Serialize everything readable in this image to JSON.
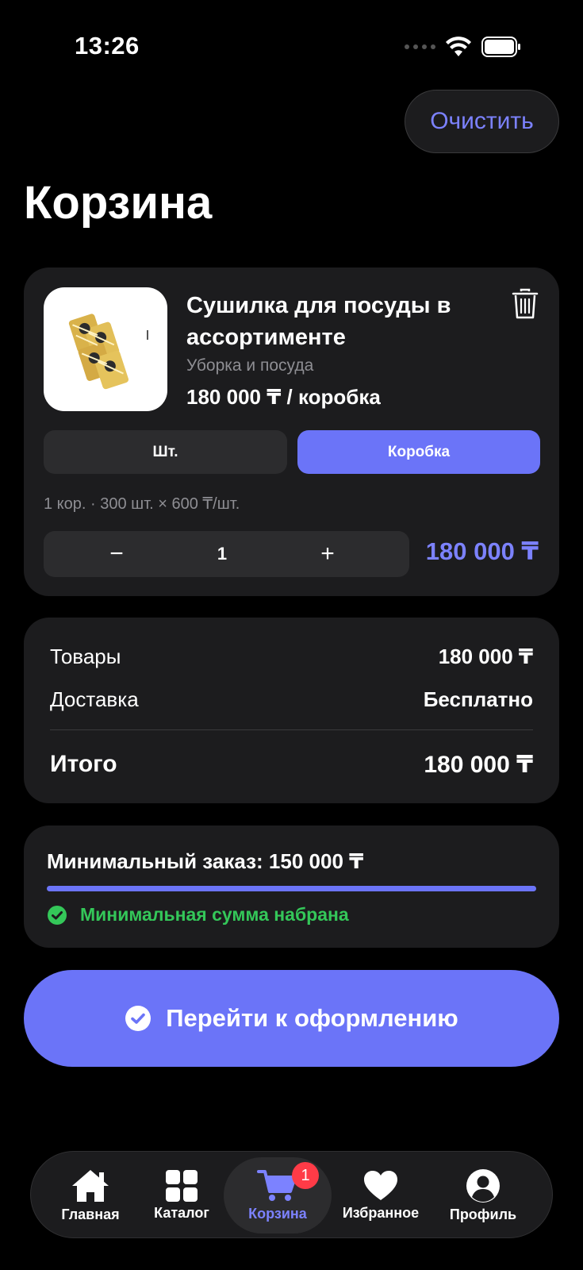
{
  "status_bar": {
    "time": "13:26"
  },
  "header": {
    "clear_label": "Очистить",
    "title": "Корзина"
  },
  "cart_item": {
    "name": "Сушилка для посуды в ассортименте",
    "category": "Уборка и посуда",
    "price": "180 000 ₸ / коробка",
    "unit_options": [
      "Шт.",
      "Коробка"
    ],
    "selected_unit": "Коробка",
    "calculation": "1 кор. · 300 шт. × 600 ₸/шт.",
    "quantity": "1",
    "minus": "−",
    "plus": "+",
    "line_total": "180 000 ₸"
  },
  "summary": {
    "goods_label": "Товары",
    "goods_value": "180 000 ₸",
    "delivery_label": "Доставка",
    "delivery_value": "Бесплатно",
    "total_label": "Итого",
    "total_value": "180 000 ₸"
  },
  "min_order": {
    "title": "Минимальный заказ: 150 000 ₸",
    "progress": 1.0,
    "status": "Минимальная сумма набрана"
  },
  "checkout": {
    "label": "Перейти к оформлению"
  },
  "tabbar": {
    "home": "Главная",
    "catalog": "Каталог",
    "cart": "Корзина",
    "cart_badge": "1",
    "favorites": "Избранное",
    "profile": "Профиль",
    "active": "cart"
  },
  "colors": {
    "accent": "#6b74f8",
    "success": "#34c759",
    "badge": "#ff3b47",
    "card": "#1c1c1e"
  }
}
